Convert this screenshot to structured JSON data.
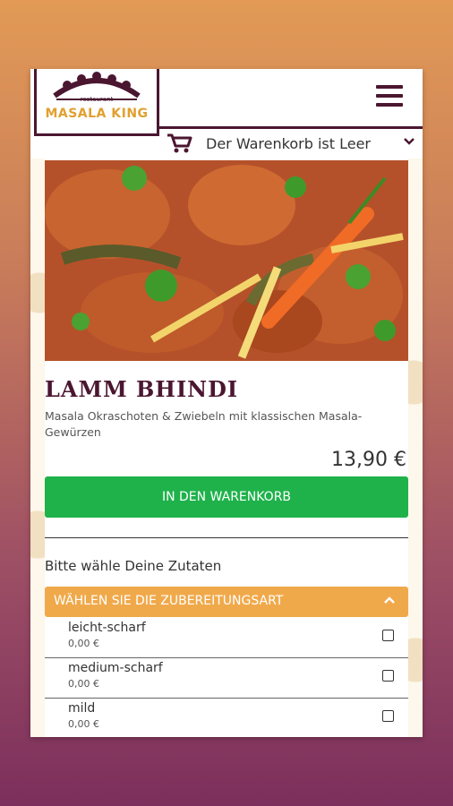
{
  "brand": {
    "subtitle": "restaurant",
    "name": "MASALA KING"
  },
  "cart": {
    "label": "Der Warenkorb ist Leer"
  },
  "product": {
    "title": "LAMM BHINDI",
    "description": "Masala Okraschoten & Zwiebeln mit klassischen Masala-Gewürzen",
    "price": "13,90 €",
    "add_button": "IN DEN WARENKORB"
  },
  "ingredients": {
    "label": "Bitte wähle Deine Zutaten",
    "section_title": "WÄHLEN SIE DIE ZUBEREITUNGSART",
    "options": [
      {
        "name": "leicht-scharf",
        "price": "0,00 €"
      },
      {
        "name": "medium-scharf",
        "price": "0,00 €"
      },
      {
        "name": "mild",
        "price": "0,00 €"
      }
    ]
  },
  "colors": {
    "brand_dark": "#4b1630",
    "brand_gold": "#e0a030",
    "add_button": "#1fb24b",
    "accordion": "#f0a94a"
  },
  "icons": [
    "menu-icon",
    "cart-icon",
    "chevron-down-icon",
    "chevron-up-icon",
    "checkbox-icon"
  ]
}
